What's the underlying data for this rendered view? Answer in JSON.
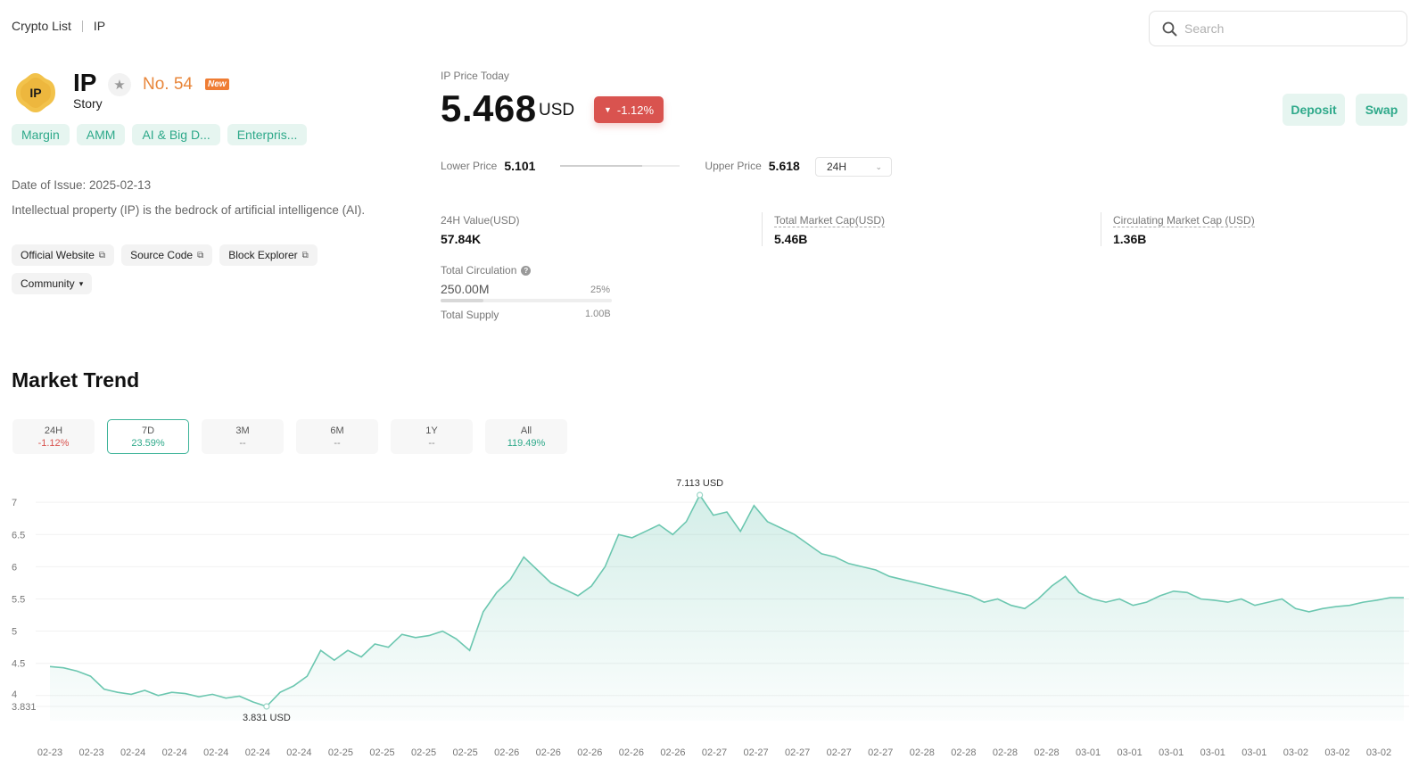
{
  "breadcrumb": {
    "root": "Crypto List",
    "current": "IP"
  },
  "search": {
    "placeholder": "Search"
  },
  "token": {
    "logo_text": "IP",
    "symbol": "IP",
    "name": "Story",
    "rank": "No. 54",
    "badge": "New",
    "tags": [
      "Margin",
      "AMM",
      "AI & Big D...",
      "Enterpris..."
    ],
    "issue_date": "Date of Issue: 2025-02-13",
    "description": "Intellectual property (IP) is the bedrock of artificial intelligence (AI).",
    "links": [
      "Official Website",
      "Source Code",
      "Block Explorer"
    ],
    "community": "Community"
  },
  "price": {
    "label": "IP Price Today",
    "value": "5.468",
    "unit": "USD",
    "change": "-1.12%",
    "lower_label": "Lower Price",
    "lower_value": "5.101",
    "upper_label": "Upper Price",
    "upper_value": "5.618",
    "range_position": 0.68,
    "period": "24H"
  },
  "actions": {
    "deposit": "Deposit",
    "swap": "Swap"
  },
  "stats": {
    "value_label": "24H Value(USD)",
    "value": "57.84K",
    "mcap_label": "Total Market Cap(USD)",
    "mcap": "5.46B",
    "circ_mcap_label": "Circulating Market Cap (USD)",
    "circ_mcap": "1.36B",
    "circulation_label": "Total Circulation",
    "circulation": "250.00M",
    "circulation_pct": "25%",
    "circulation_fraction": 0.25,
    "supply_label": "Total Supply",
    "supply": "1.00B"
  },
  "trend": {
    "title": "Market Trend",
    "periods": [
      {
        "label": "24H",
        "value": "-1.12%",
        "kind": "neg",
        "active": false
      },
      {
        "label": "7D",
        "value": "23.59%",
        "kind": "pos",
        "active": true
      },
      {
        "label": "3M",
        "value": "--",
        "kind": "none",
        "active": false
      },
      {
        "label": "6M",
        "value": "--",
        "kind": "none",
        "active": false
      },
      {
        "label": "1Y",
        "value": "--",
        "kind": "none",
        "active": false
      },
      {
        "label": "All",
        "value": "119.49%",
        "kind": "pos",
        "active": false
      }
    ]
  },
  "colors": {
    "accent": "#2ea98a",
    "negative": "#d9534f",
    "rank": "#e8863a"
  },
  "chart_data": {
    "type": "area",
    "y_ticks": [
      "7",
      "6.5",
      "6",
      "5.5",
      "5",
      "4.5",
      "4",
      "3.831"
    ],
    "ylim": [
      3.831,
      7.113
    ],
    "x_ticks": [
      "02-23",
      "02-23",
      "02-24",
      "02-24",
      "02-24",
      "02-24",
      "02-24",
      "02-25",
      "02-25",
      "02-25",
      "02-25",
      "02-26",
      "02-26",
      "02-26",
      "02-26",
      "02-26",
      "02-27",
      "02-27",
      "02-27",
      "02-27",
      "02-27",
      "02-28",
      "02-28",
      "02-28",
      "02-28",
      "03-01",
      "03-01",
      "03-01",
      "03-01",
      "03-01",
      "03-02",
      "03-02",
      "03-02"
    ],
    "max_label": "7.113 USD",
    "min_label": "3.831 USD",
    "max_index": 48,
    "min_index": 16,
    "values": [
      4.45,
      4.43,
      4.38,
      4.3,
      4.1,
      4.05,
      4.02,
      4.08,
      4.0,
      4.05,
      4.03,
      3.98,
      4.02,
      3.96,
      3.99,
      3.9,
      3.831,
      4.05,
      4.15,
      4.3,
      4.7,
      4.55,
      4.7,
      4.6,
      4.8,
      4.75,
      4.95,
      4.9,
      4.93,
      5.0,
      4.88,
      4.7,
      5.3,
      5.6,
      5.8,
      6.15,
      5.95,
      5.75,
      5.65,
      5.55,
      5.7,
      6.0,
      6.5,
      6.45,
      6.55,
      6.65,
      6.5,
      6.7,
      7.113,
      6.8,
      6.85,
      6.55,
      6.95,
      6.7,
      6.6,
      6.5,
      6.35,
      6.2,
      6.15,
      6.05,
      6.0,
      5.95,
      5.85,
      5.8,
      5.75,
      5.7,
      5.65,
      5.6,
      5.55,
      5.45,
      5.5,
      5.4,
      5.35,
      5.5,
      5.7,
      5.85,
      5.6,
      5.5,
      5.45,
      5.5,
      5.4,
      5.45,
      5.55,
      5.62,
      5.6,
      5.5,
      5.48,
      5.45,
      5.5,
      5.4,
      5.45,
      5.5,
      5.35,
      5.3,
      5.35,
      5.38,
      5.4,
      5.45,
      5.48,
      5.52,
      5.52
    ]
  }
}
